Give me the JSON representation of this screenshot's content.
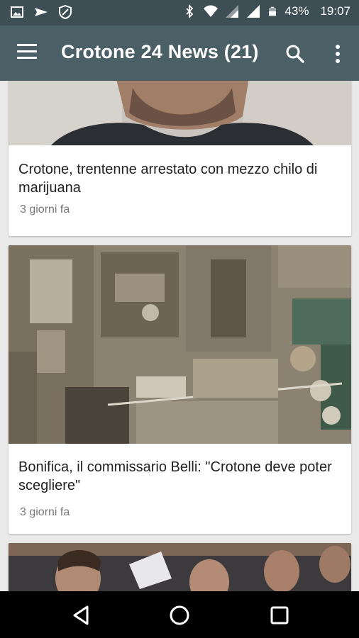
{
  "status_bar": {
    "icons_left": [
      "image-icon",
      "send-icon",
      "vpn-shield-icon"
    ],
    "icons_right": [
      "bluetooth-icon",
      "wifi-icon",
      "signal-icon",
      "signal-icon-2",
      "battery-icon"
    ],
    "battery": "43%",
    "time": "19:07"
  },
  "app_bar": {
    "title": "Crotone 24 News (21)",
    "icons": [
      "menu-icon",
      "search-icon",
      "more-vert-icon"
    ]
  },
  "articles": [
    {
      "headline": "Crotone, trentenne arrestato con mezzo chilo di marijuana",
      "age": "3 giorni fa"
    },
    {
      "headline": "Bonifica, il commissario Belli: \"Crotone deve poter scegliere\"",
      "age": "3 giorni fa"
    }
  ],
  "nav_bar": {
    "icons": [
      "back-icon",
      "home-icon",
      "recents-icon"
    ]
  },
  "colors": {
    "status_bar": "#3d4e55",
    "app_bar": "#4b5f67",
    "feed_background": "#e9e9e9"
  }
}
